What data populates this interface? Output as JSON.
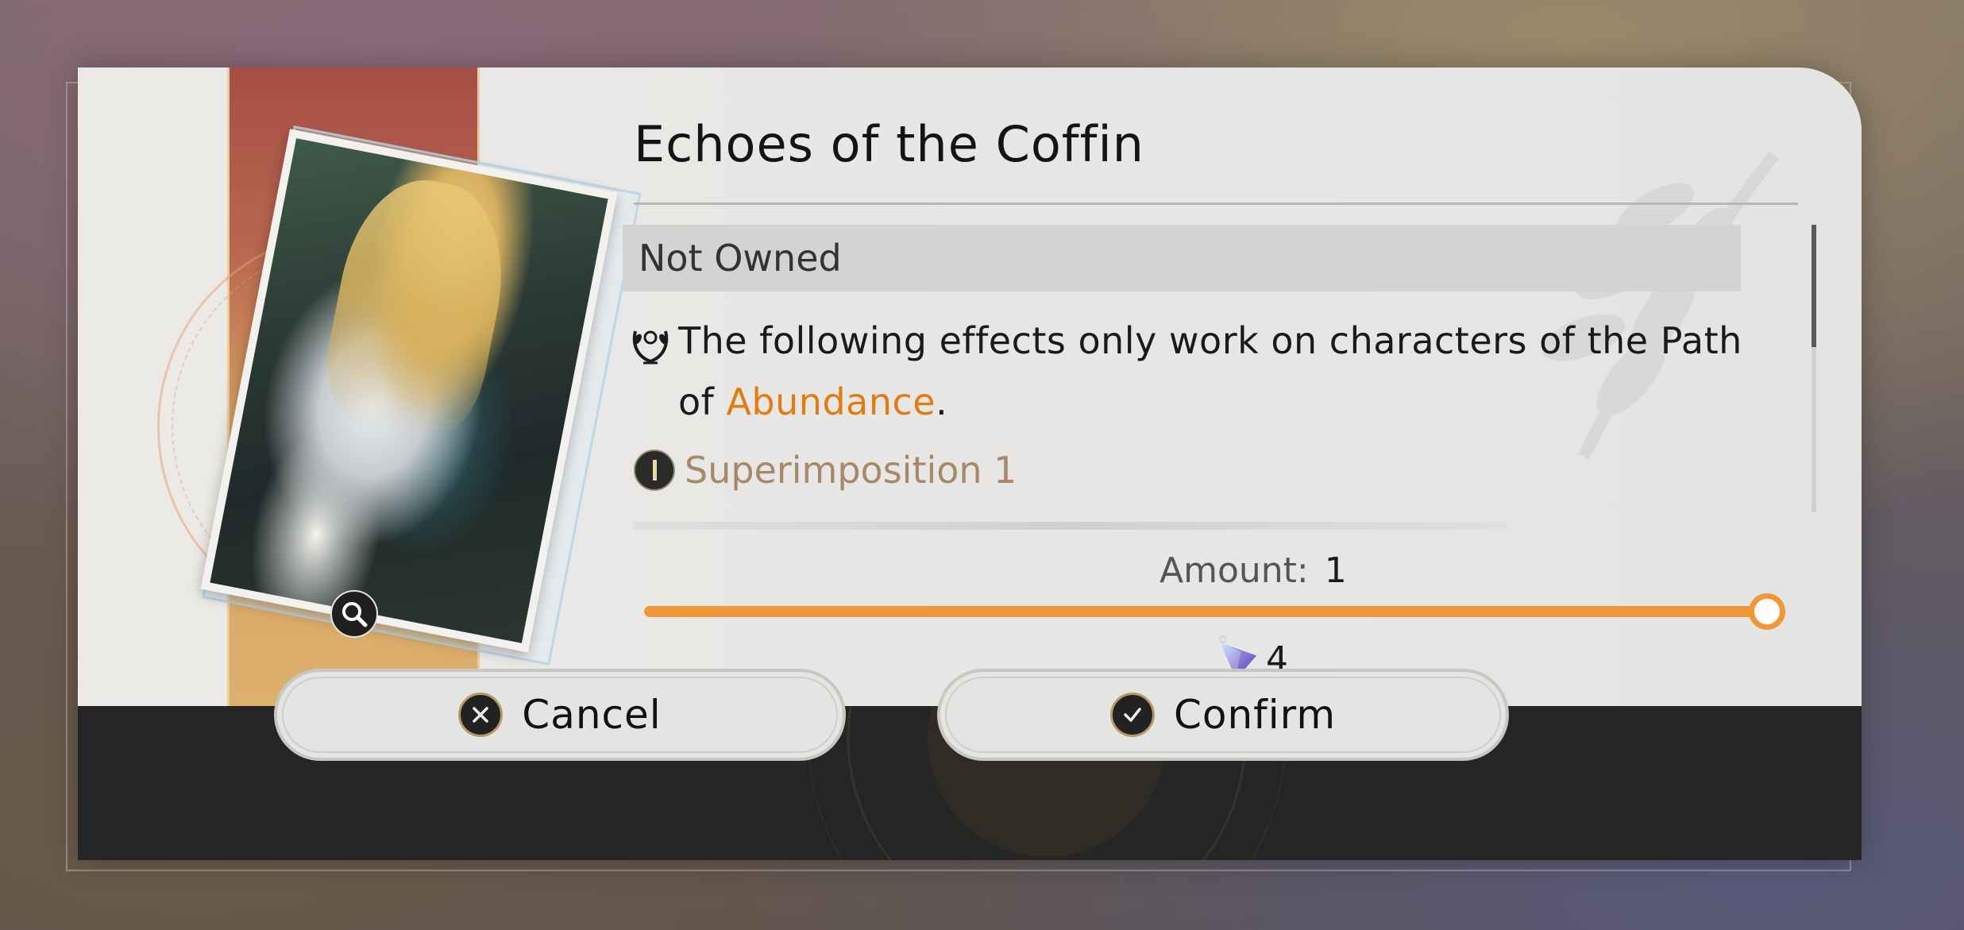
{
  "dialog": {
    "title": "Echoes of the Coffin",
    "status": "Not Owned",
    "description": {
      "prefix": "The following effects only work on characters of the Path of ",
      "path": "Abundance",
      "suffix": "."
    },
    "superimposition": "Superimposition 1",
    "amount": {
      "label": "Amount:",
      "value": "1",
      "fraction": 1.0
    },
    "cost": {
      "value": "4",
      "icon": "star-rail-special-pass-icon"
    },
    "buttons": {
      "cancel": "Cancel",
      "confirm": "Confirm"
    },
    "colors": {
      "accent": "#f0973a",
      "path_highlight": "#e07d12",
      "superimposition": "#a5896a"
    }
  }
}
